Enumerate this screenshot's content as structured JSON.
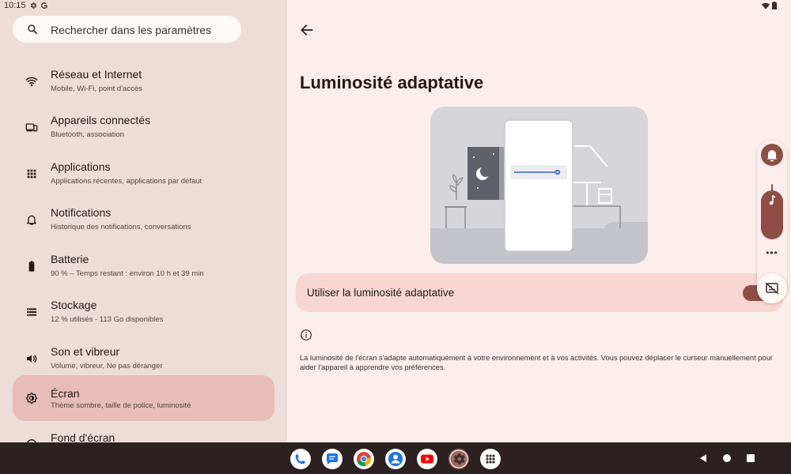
{
  "status": {
    "time": "10:15"
  },
  "search": {
    "placeholder": "Rechercher dans les paramètres"
  },
  "sidebar": {
    "items": [
      {
        "title": "Réseau et Internet",
        "subtitle": "Mobile, Wi-Fi, point d'accès",
        "icon": "wifi-icon"
      },
      {
        "title": "Appareils connectés",
        "subtitle": "Bluetooth, association",
        "icon": "devices-icon"
      },
      {
        "title": "Applications",
        "subtitle": "Applications récentes, applications par défaut",
        "icon": "apps-grid-icon"
      },
      {
        "title": "Notifications",
        "subtitle": "Historique des notifications, conversations",
        "icon": "bell-icon"
      },
      {
        "title": "Batterie",
        "subtitle": "90 % – Temps restant : environ 10 h et 39 min",
        "icon": "battery-icon"
      },
      {
        "title": "Stockage",
        "subtitle": "12 % utilisés - 113 Go disponibles",
        "icon": "storage-icon"
      },
      {
        "title": "Son et vibreur",
        "subtitle": "Volume, vibreur, Ne pas déranger",
        "icon": "volume-icon"
      },
      {
        "title": "Écran",
        "subtitle": "Thème sombre, taille de police, luminosité",
        "icon": "brightness-icon",
        "active": true
      },
      {
        "title": "Fond d'écran",
        "subtitle": "",
        "icon": "wallpaper-icon"
      }
    ]
  },
  "main": {
    "title": "Luminosité adaptative",
    "toggle": {
      "label": "Utiliser la luminosité adaptative",
      "checked": true
    },
    "description": "La luminosité de l'écran s'adapte automatiquement à votre environnement et à vos activités. Vous pouvez déplacer le curseur manuellement pour aider l'appareil à apprendre vos préférences."
  },
  "volume": {
    "more": "•••"
  },
  "colors": {
    "accent": "#8e4e45",
    "active_bg": "#e8bdb7",
    "toggle_row_bg": "#f9d6d1",
    "sidebar_bg": "#eedcd9",
    "taskbar_bg": "#2b2120"
  },
  "taskbar": {
    "apps": [
      "phone-icon",
      "messages-icon",
      "chrome-icon",
      "contacts-icon",
      "youtube-icon",
      "settings-icon",
      "app-drawer-icon"
    ]
  }
}
